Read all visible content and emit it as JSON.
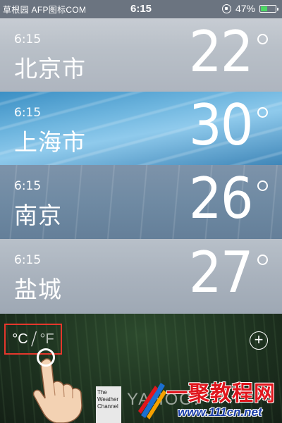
{
  "status_bar": {
    "carrier": "草根园 AFP图标COM",
    "time": "6:15",
    "battery": "47%",
    "battery_level": 0.47
  },
  "cities": [
    {
      "time": "6:15",
      "name": "北京市",
      "temp": "22"
    },
    {
      "time": "6:15",
      "name": "上海市",
      "temp": "30"
    },
    {
      "time": "6:15",
      "name": "南京",
      "temp": "26"
    },
    {
      "time": "6:15",
      "name": "盐城",
      "temp": "27"
    }
  ],
  "footer": {
    "unit_c": "°C",
    "unit_sep": "/",
    "unit_f": "°F",
    "add_label": "+",
    "weather_channel_text": "The Weather Channel",
    "yahoo_text": "YAHOO!",
    "watermark_title": "一聚教程网",
    "watermark_url": "www.111cn.net"
  },
  "colors": {
    "highlight_box": "#e5372c",
    "battery_fill": "#4cd964",
    "watermark_red": "#e0161d",
    "watermark_blue": "#1b3fa8"
  }
}
